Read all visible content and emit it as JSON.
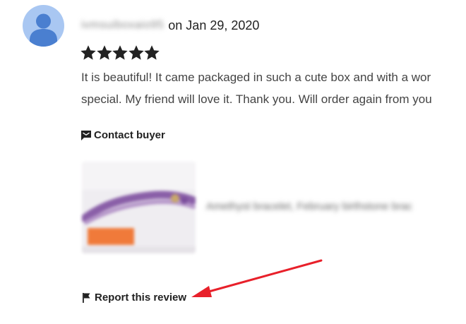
{
  "review": {
    "reviewer_name": "ivmsuiboxaio95",
    "date_text": "on Jan 29, 2020",
    "rating": 5,
    "rating_max": 5,
    "text_lines": [
      "It is beautiful! It came packaged in such a cute box and with a wor",
      "special. My friend will love it. Thank you. Will order again from you"
    ]
  },
  "actions": {
    "contact_buyer_label": "Contact buyer",
    "report_label": "Report this review"
  },
  "product": {
    "title": "Amethyst bracelet, February birthstone brac"
  },
  "icons": {
    "avatar": "avatar-placeholder-icon",
    "star": "star-icon",
    "contact": "message-icon",
    "report": "flag-icon"
  },
  "colors": {
    "avatar_bg": "#a9c7f2",
    "avatar_fg": "#4a7fd0",
    "star": "#222222",
    "annotation_arrow": "#e8202a"
  }
}
